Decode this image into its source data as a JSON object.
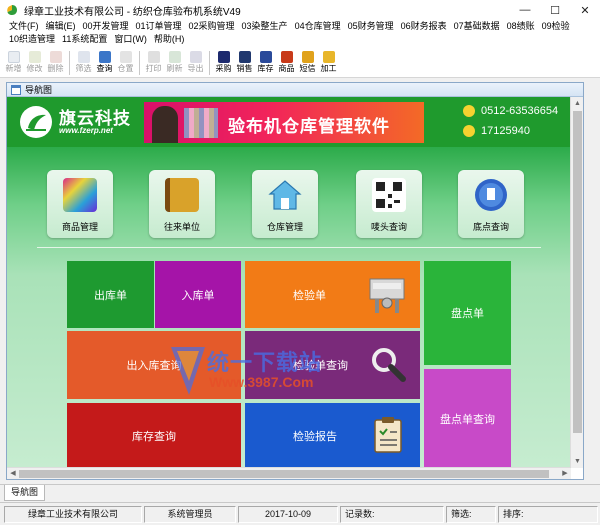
{
  "window": {
    "title": "绿章工业技术有限公司 - 纺织仓库验布机系统V49",
    "min": "—",
    "max": "☐",
    "close": "✕"
  },
  "menu": [
    "文件(F)",
    "编辑(E)",
    "00开发管理",
    "01订单管理",
    "02采购管理",
    "03染整生产",
    "04仓库管理",
    "05财务管理",
    "06财务报表",
    "07基础数据",
    "08绩账",
    "09检验",
    "10织造管理",
    "11系统配置",
    "窗口(W)",
    "帮助(H)"
  ],
  "toolbar": {
    "groups": [
      [
        {
          "label": "新增",
          "icon": "new-icon",
          "enabled": false
        },
        {
          "label": "修改",
          "icon": "edit-icon",
          "enabled": false
        },
        {
          "label": "删除",
          "icon": "delete-icon",
          "enabled": false
        }
      ],
      [
        {
          "label": "筛选",
          "icon": "filter-icon",
          "enabled": false
        },
        {
          "label": "查询",
          "icon": "query-icon",
          "enabled": true
        },
        {
          "label": "仓置",
          "icon": "grid-icon",
          "enabled": false
        }
      ],
      [
        {
          "label": "打印",
          "icon": "print-icon",
          "enabled": false
        },
        {
          "label": "刷新",
          "icon": "refresh-icon",
          "enabled": false
        },
        {
          "label": "导出",
          "icon": "export-icon",
          "enabled": false
        }
      ],
      [
        {
          "label": "采购",
          "icon": "purchase-icon",
          "enabled": true
        },
        {
          "label": "销售",
          "icon": "sales-icon",
          "enabled": true
        },
        {
          "label": "库存",
          "icon": "inventory-icon",
          "enabled": true
        },
        {
          "label": "商品",
          "icon": "goods-icon",
          "enabled": true
        },
        {
          "label": "短信",
          "icon": "sms-icon",
          "enabled": true
        },
        {
          "label": "加工",
          "icon": "process-icon",
          "enabled": true
        }
      ]
    ]
  },
  "child_window": {
    "title": "导航图"
  },
  "header": {
    "brand": "旗云科技",
    "url": "www.fzerp.net",
    "banner_text": "验布机仓库管理软件",
    "phone": "0512-63536654",
    "qq": "17125940"
  },
  "icon_buttons": [
    {
      "label": "商品管理",
      "icon": "fabric-icon",
      "color": "#c03a8a"
    },
    {
      "label": "往来单位",
      "icon": "contacts-book-icon",
      "color": "#c9951c"
    },
    {
      "label": "仓库管理",
      "icon": "warehouse-icon",
      "color": "#4aa6d8"
    },
    {
      "label": "唛头查询",
      "icon": "qrcode-icon",
      "color": "#3a3a3a"
    },
    {
      "label": "底点查询",
      "icon": "search-globe-icon",
      "color": "#2456b8"
    }
  ],
  "tiles": {
    "outbound": "出库单",
    "inbound": "入库单",
    "inspection": "检验单",
    "stocktake": "盘点单",
    "in_out_query": "出入库查询",
    "inspection_query": "检验单查询",
    "stocktake_query": "盘点单查询",
    "inventory_query": "库存查询",
    "inspection_report": "检验报告"
  },
  "watermark": {
    "text": "统一下载站",
    "url": "Www.3987.Com"
  },
  "bottom_tab": "导航图",
  "status": {
    "company": "绿章工业技术有限公司",
    "user": "系统管理员",
    "date": "2017-10-09",
    "records_label": "记录数:",
    "filter_label": "筛选:",
    "sort_label": "排序:"
  }
}
